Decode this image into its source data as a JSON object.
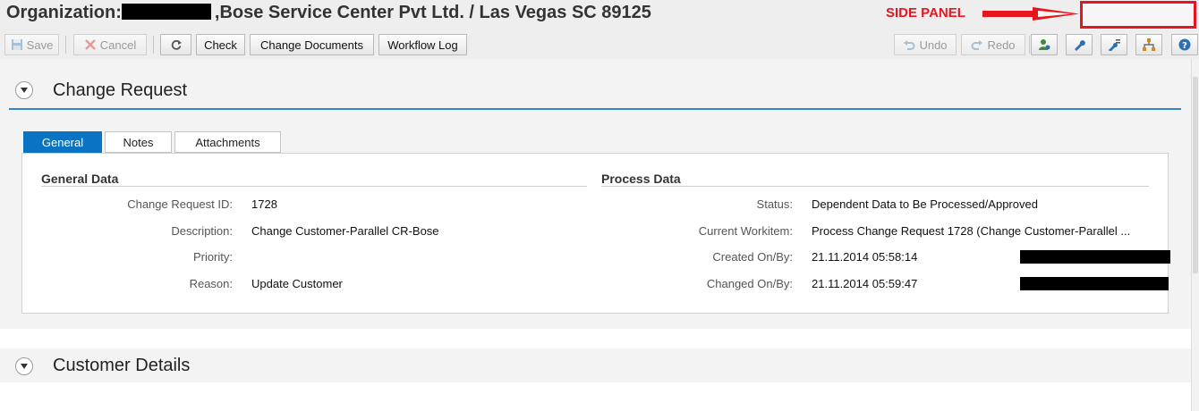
{
  "window": {
    "title_prefix": "Organization:",
    "title_suffix": ",Bose Service Center Pvt Ltd. / Las Vegas SC 89125",
    "annotation_label": "SIDE PANEL",
    "annotation_color": "#e8141e"
  },
  "toolbar": {
    "save_label": "Save",
    "cancel_label": "Cancel",
    "check_label": "Check",
    "change_documents_label": "Change Documents",
    "workflow_log_label": "Workflow Log",
    "undo_label": "Undo",
    "redo_label": "Redo"
  },
  "sections": {
    "change_request_title": "Change Request",
    "customer_details_title": "Customer Details"
  },
  "tabs": [
    {
      "label": "General",
      "active": true
    },
    {
      "label": "Notes",
      "active": false
    },
    {
      "label": "Attachments",
      "active": false
    }
  ],
  "general_data": {
    "title": "General Data",
    "fields": [
      {
        "label": "Change Request ID:",
        "value": "1728"
      },
      {
        "label": "Description:",
        "value": "Change Customer-Parallel CR-Bose"
      },
      {
        "label": "Priority:",
        "value": ""
      },
      {
        "label": "Reason:",
        "value": "Update Customer"
      }
    ]
  },
  "process_data": {
    "title": "Process Data",
    "fields": [
      {
        "label": "Status:",
        "value": "Dependent Data to Be Processed/Approved"
      },
      {
        "label": "Current Workitem:",
        "value": "Process Change Request 1728 (Change Customer-Parallel ..."
      },
      {
        "label": "Created On/By:",
        "value": "21.11.2014 05:58:14"
      },
      {
        "label": "Changed On/By:",
        "value": "21.11.2014 05:59:47"
      }
    ]
  },
  "colors": {
    "accent": "#0a73c2",
    "section_rule": "#2f86c4"
  }
}
